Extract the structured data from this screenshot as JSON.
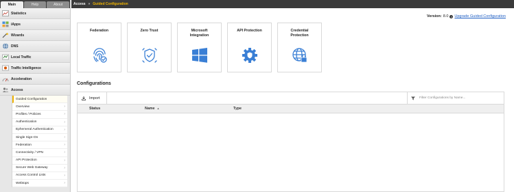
{
  "tabs": [
    "Main",
    "Help",
    "About"
  ],
  "nav": [
    {
      "label": "Statistics",
      "icon": "statistics-icon"
    },
    {
      "label": "iApps",
      "icon": "iapps-icon"
    },
    {
      "label": "Wizards",
      "icon": "wizards-icon"
    },
    {
      "label": "DNS",
      "icon": "dns-icon"
    },
    {
      "label": "Local Traffic",
      "icon": "local-traffic-icon"
    },
    {
      "label": "Traffic Intelligence",
      "icon": "traffic-intelligence-icon"
    },
    {
      "label": "Acceleration",
      "icon": "acceleration-icon"
    },
    {
      "label": "Access",
      "icon": "access-icon"
    }
  ],
  "access_menu": [
    {
      "label": "Guided Configuration",
      "arrow": ""
    },
    {
      "label": "Overview",
      "arrow": "›"
    },
    {
      "label": "Profiles / Policies",
      "arrow": "›"
    },
    {
      "label": "Authentication",
      "arrow": "›"
    },
    {
      "label": "Ephemeral Authentication",
      "arrow": "›"
    },
    {
      "label": "Single Sign-On",
      "arrow": "›"
    },
    {
      "label": "Federation",
      "arrow": "›"
    },
    {
      "label": "Connectivity / VPN",
      "arrow": "›"
    },
    {
      "label": "API Protection",
      "arrow": "›"
    },
    {
      "label": "Secure Web Gateway",
      "arrow": "›"
    },
    {
      "label": "Access Control Lists",
      "arrow": "›"
    },
    {
      "label": "Webtops",
      "arrow": "›"
    }
  ],
  "breadcrumb": {
    "root": "Access",
    "separator": "»",
    "current": "Guided Configuration"
  },
  "version": {
    "label": "Version:",
    "value": "8.0",
    "upgrade_link": "Upgrade Guided Configuration"
  },
  "cards": [
    {
      "title": "Federation",
      "icon": "fingerprint-icon"
    },
    {
      "title": "Zero Trust",
      "icon": "shield-check-icon"
    },
    {
      "title": "Microsoft\nIntegration",
      "icon": "windows-icon"
    },
    {
      "title": "API Protection",
      "icon": "gear-shield-icon"
    },
    {
      "title": "Credential\nProtection",
      "icon": "globe-lock-icon"
    }
  ],
  "configurations": {
    "title": "Configurations",
    "import_label": "Import",
    "filter_placeholder": "Filter Configurations by Name...",
    "columns": {
      "status": "Status",
      "name": "Name",
      "sort": "▲",
      "type": "Type"
    }
  },
  "colors": {
    "accent": "#f0b400",
    "icon_blue": "#3a7fd5",
    "link": "#1f5fc4"
  }
}
